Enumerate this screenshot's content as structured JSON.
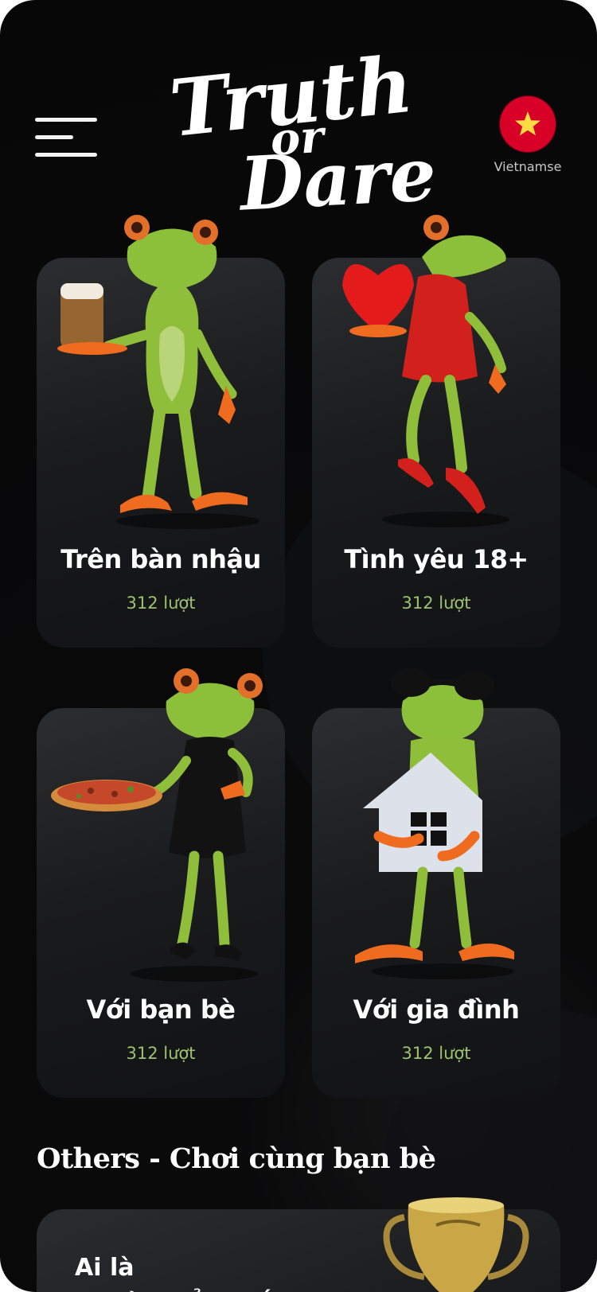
{
  "header": {
    "menu_icon": "hamburger-menu-icon",
    "logo_lines": [
      "Truth",
      "or",
      "Dare"
    ],
    "language": {
      "label": "Vietnamse",
      "flag_icon": "vietnam-flag-icon"
    }
  },
  "categories": [
    {
      "title": "Trên bàn nhậu",
      "count": "312 lượt",
      "illustration": "frog-with-beer"
    },
    {
      "title": "Tình yêu 18+",
      "count": "312 lượt",
      "illustration": "frog-with-heart"
    },
    {
      "title": "Với bạn bè",
      "count": "312 lượt",
      "illustration": "frog-with-pizza"
    },
    {
      "title": "Với gia đình",
      "count": "312 lượt",
      "illustration": "frog-with-house"
    }
  ],
  "others": {
    "title": "Others - Chơi cùng bạn bè",
    "card_title_line1": "Ai là",
    "card_title_line2": "người hiểu thế",
    "illustration": "trophy"
  },
  "colors": {
    "background": "#0a0a0b",
    "card": "#1f2022",
    "accent_count": "#9dc26e",
    "flag_red": "#d80027",
    "flag_star": "#ffda44"
  }
}
